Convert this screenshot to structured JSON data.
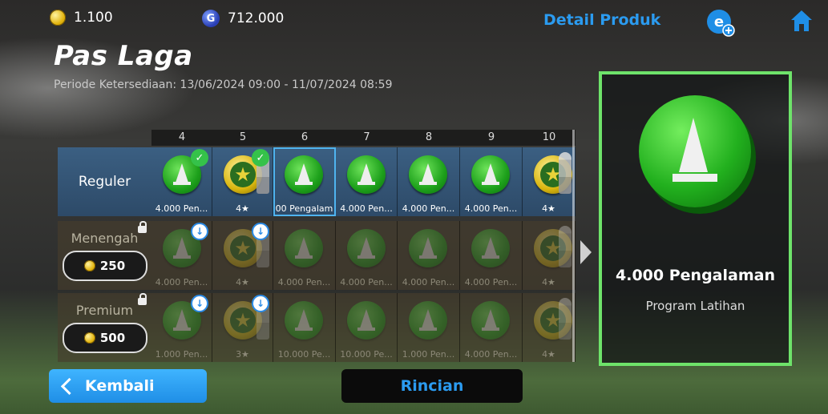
{
  "header": {
    "coins": "1.100",
    "gp": "712.000",
    "gp_symbol": "G",
    "detail_link": "Detail Produk",
    "title": "Pas Laga",
    "period": "Periode Ketersediaan: 13/06/2024 09:00 - 11/07/2024 08:59"
  },
  "columns": [
    "4",
    "5",
    "6",
    "7",
    "8",
    "9",
    "10"
  ],
  "rows": [
    {
      "name": "Reguler",
      "cells": [
        {
          "type": "cone",
          "label": "4.000 Pen...",
          "badge": "check"
        },
        {
          "type": "star",
          "label": "4★",
          "badge": "check",
          "player": true
        },
        {
          "type": "cone",
          "label": "00 Pengalam",
          "selected": true
        },
        {
          "type": "cone",
          "label": "4.000 Pen..."
        },
        {
          "type": "cone",
          "label": "4.000 Pen..."
        },
        {
          "type": "cone",
          "label": "4.000 Pen..."
        },
        {
          "type": "star",
          "label": "4★",
          "player": true
        }
      ]
    },
    {
      "name": "Menengah",
      "price": "250",
      "cells": [
        {
          "type": "cone",
          "label": "4.000 Pen...",
          "badge": "dl"
        },
        {
          "type": "star",
          "label": "4★",
          "badge": "dl",
          "player": true
        },
        {
          "type": "cone",
          "label": "4.000 Pen..."
        },
        {
          "type": "cone",
          "label": "4.000 Pen..."
        },
        {
          "type": "cone",
          "label": "4.000 Pen..."
        },
        {
          "type": "cone",
          "label": "4.000 Pen..."
        },
        {
          "type": "star",
          "label": "4★",
          "player": true
        }
      ]
    },
    {
      "name": "Premium",
      "price": "500",
      "cells": [
        {
          "type": "cone",
          "label": "1.000 Pen...",
          "badge": "dl"
        },
        {
          "type": "star",
          "label": "3★",
          "badge": "dl",
          "player": true
        },
        {
          "type": "cone",
          "label": "10.000 Pe..."
        },
        {
          "type": "cone",
          "label": "10.000 Pe..."
        },
        {
          "type": "cone",
          "label": "1.000 Pen..."
        },
        {
          "type": "cone",
          "label": "4.000 Pen..."
        },
        {
          "type": "star",
          "label": "4★",
          "player": true
        }
      ]
    }
  ],
  "detail_panel": {
    "title": "4.000 Pengalaman",
    "subtitle": "Program Latihan"
  },
  "buttons": {
    "back": "Kembali",
    "details": "Rincian"
  },
  "colors": {
    "accent": "#2b9bf0",
    "highlight": "#6ee36a"
  }
}
